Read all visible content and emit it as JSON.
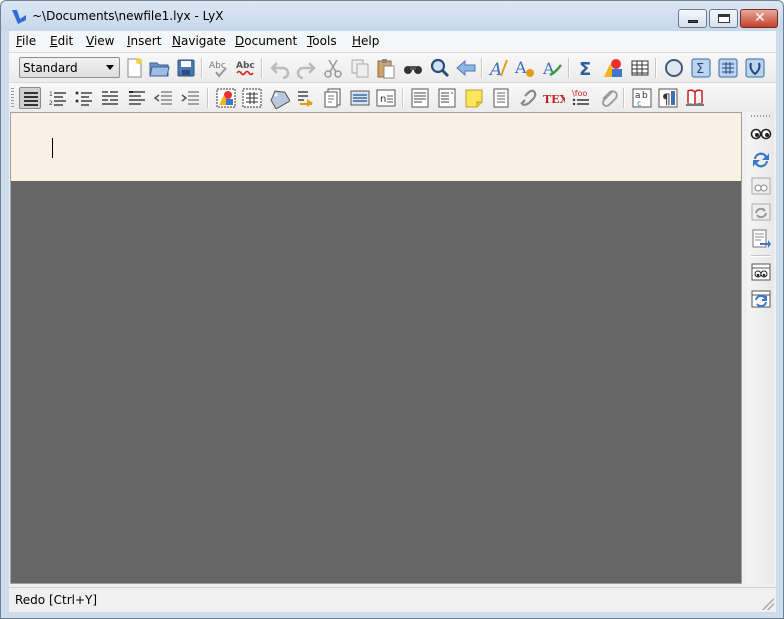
{
  "window": {
    "title": "~\\Documents\\newfile1.lyx - LyX",
    "app_icon": "lyx-logo-icon",
    "controls": [
      "minimize-icon",
      "maximize-icon",
      "close-icon"
    ]
  },
  "menubar": [
    {
      "label": "File",
      "mnemonic": "F",
      "rest": "ile"
    },
    {
      "label": "Edit",
      "mnemonic": "E",
      "rest": "dit"
    },
    {
      "label": "View",
      "mnemonic": "V",
      "rest": "iew"
    },
    {
      "label": "Insert",
      "mnemonic": "I",
      "rest": "nsert"
    },
    {
      "label": "Navigate",
      "mnemonic": "N",
      "rest": "avigate"
    },
    {
      "label": "Document",
      "mnemonic": "D",
      "rest": "ocument"
    },
    {
      "label": "Tools",
      "mnemonic": "T",
      "rest": "ools"
    },
    {
      "label": "Help",
      "mnemonic": "H",
      "rest": "elp"
    }
  ],
  "toolbar1": {
    "layout_combo": {
      "value": "Standard"
    },
    "icons": [
      "new-document-icon",
      "open-folder-icon",
      "save-icon",
      "spellcheck-icon",
      "spellcheck-continuous-icon",
      "undo-icon",
      "redo-icon",
      "cut-icon",
      "copy-icon",
      "paste-icon",
      "find-replace-icon",
      "search-icon",
      "navigate-back-icon",
      "text-style-icon",
      "text-style-custom-icon",
      "text-style-change-icon",
      "math-sum-icon",
      "insert-graphics-icon",
      "insert-table-icon",
      "compass-icon",
      "math-panel-icon",
      "table-panel-icon",
      "view-source-icon"
    ]
  },
  "toolbar2": {
    "icons": [
      "paragraph-standard-icon",
      "enumerate-list-icon",
      "itemize-list-icon",
      "description-list-icon",
      "list-icon",
      "decrease-depth-icon",
      "increase-depth-icon",
      "insert-figure-float-icon",
      "insert-table-float-icon",
      "insert-label-icon",
      "insert-cross-ref-icon",
      "insert-citation-icon",
      "insert-index-icon",
      "insert-nomenclature-icon",
      "insert-footnote-icon",
      "insert-marginnote-icon",
      "insert-note-icon",
      "insert-box-icon",
      "insert-hyperlink-icon",
      "insert-tex-code-icon",
      "insert-bibliography-icon",
      "attach-icon",
      "change-case-icon",
      "paragraph-settings-icon",
      "document-settings-icon"
    ]
  },
  "vertical_toolbar": {
    "icons": [
      "view-icon",
      "update-icon",
      "view-master-icon",
      "update-master-icon",
      "export-icon",
      "view-other-icon",
      "update-other-icon"
    ]
  },
  "document": {
    "background_color": "#666666",
    "page_color": "#faf0e6"
  },
  "statusbar": {
    "text": "Redo [Ctrl+Y]"
  }
}
